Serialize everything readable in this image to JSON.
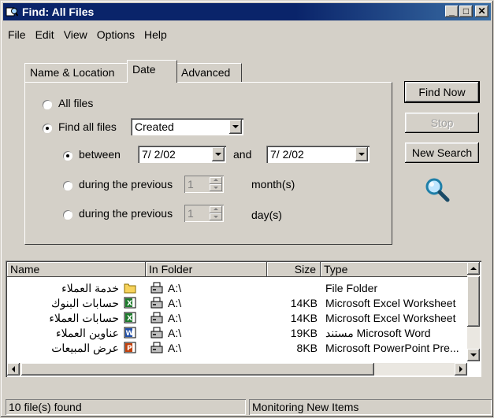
{
  "window": {
    "title": "Find: All Files",
    "minimize_icon": "minimize-icon",
    "maximize_icon": "maximize-icon",
    "close_icon": "close-icon"
  },
  "menu": [
    "File",
    "Edit",
    "View",
    "Options",
    "Help"
  ],
  "tabs": [
    "Name & Location",
    "Date",
    "Advanced"
  ],
  "active_tab": "Date",
  "date_panel": {
    "all_files_label": "All files",
    "find_all_files_label": "Find all files",
    "find_mode_selected": "Created",
    "between_label": "between",
    "from_date": "7/ 2/02",
    "and_label": "and",
    "to_date": "7/ 2/02",
    "during_prev_label_1": "during the previous",
    "months_value": "1",
    "months_unit": "month(s)",
    "during_prev_label_2": "during the previous",
    "days_value": "1",
    "days_unit": "day(s)"
  },
  "buttons": {
    "find_now": "Find Now",
    "stop": "Stop",
    "new_search": "New Search",
    "search_icon": "magnifier-icon"
  },
  "results": {
    "columns": [
      "Name",
      "In Folder",
      "Size",
      "Type"
    ],
    "rows": [
      {
        "name": "خدمة العملاء",
        "folder": "A:\\",
        "size": "",
        "type": "File Folder",
        "icon": "folder-icon"
      },
      {
        "name": "حسابات البنوك",
        "folder": "A:\\",
        "size": "14KB",
        "type": "Microsoft Excel Worksheet",
        "icon": "excel-icon"
      },
      {
        "name": "حسابات العملاء",
        "folder": "A:\\",
        "size": "14KB",
        "type": "Microsoft Excel Worksheet",
        "icon": "excel-icon"
      },
      {
        "name": "عناوين العملاء",
        "folder": "A:\\",
        "size": "19KB",
        "type": "مستند Microsoft Word",
        "icon": "word-icon"
      },
      {
        "name": "عرض المبيعات",
        "folder": "A:\\",
        "size": "8KB",
        "type": "Microsoft PowerPoint Pre...",
        "icon": "powerpoint-icon"
      }
    ]
  },
  "status": {
    "count": "10 file(s) found",
    "monitoring": "Monitoring New Items"
  }
}
